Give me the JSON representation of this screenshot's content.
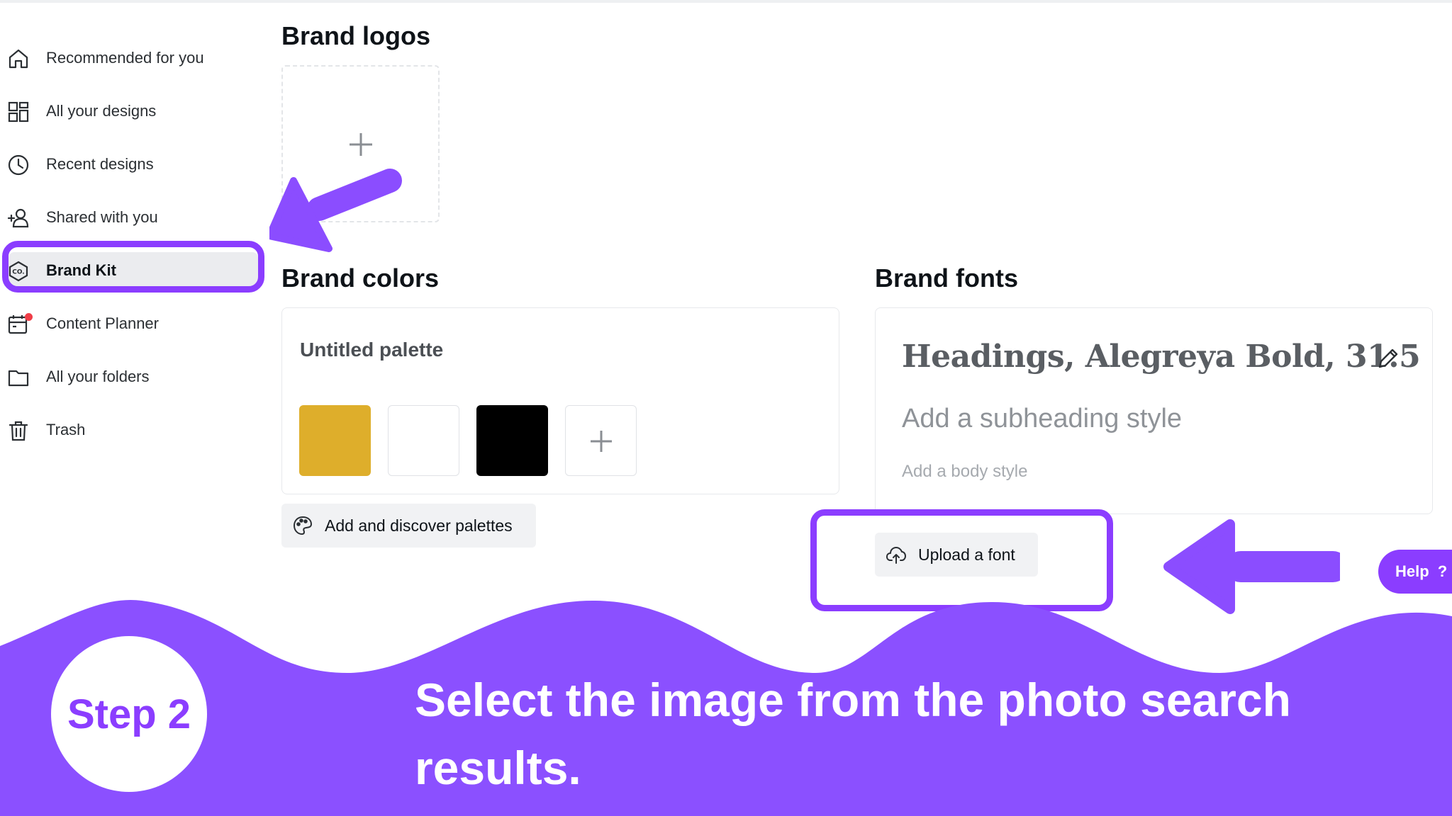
{
  "sidebar": {
    "items": [
      {
        "label": "Recommended for you",
        "icon": "home-icon"
      },
      {
        "label": "All your designs",
        "icon": "grid-icon"
      },
      {
        "label": "Recent designs",
        "icon": "clock-icon"
      },
      {
        "label": "Shared with you",
        "icon": "people-icon"
      },
      {
        "label": "Brand Kit",
        "icon": "brand-kit-icon",
        "active": true
      },
      {
        "label": "Content Planner",
        "icon": "calendar-icon"
      },
      {
        "label": "All your folders",
        "icon": "folder-icon"
      },
      {
        "label": "Trash",
        "icon": "trash-icon"
      }
    ]
  },
  "brand_logos": {
    "title": "Brand logos",
    "add_icon": "plus-icon"
  },
  "brand_colors": {
    "title": "Brand colors",
    "palette_name": "Untitled palette",
    "swatches": [
      "#deae2b",
      "#ffffff",
      "#000000"
    ],
    "add_palettes_label": "Add and discover palettes"
  },
  "brand_fonts": {
    "title": "Brand fonts",
    "heading": "Headings, Alegreya Bold, 31.5",
    "subheading": "Add a subheading style",
    "body": "Add a body style",
    "upload_label": "Upload a font"
  },
  "help": {
    "label": "Help",
    "symbol": "?"
  },
  "tutorial": {
    "step": "Step 2",
    "instruction": "Select the image from the photo search results."
  },
  "colors": {
    "accent": "#8b3dff",
    "notification": "#f03e48"
  }
}
